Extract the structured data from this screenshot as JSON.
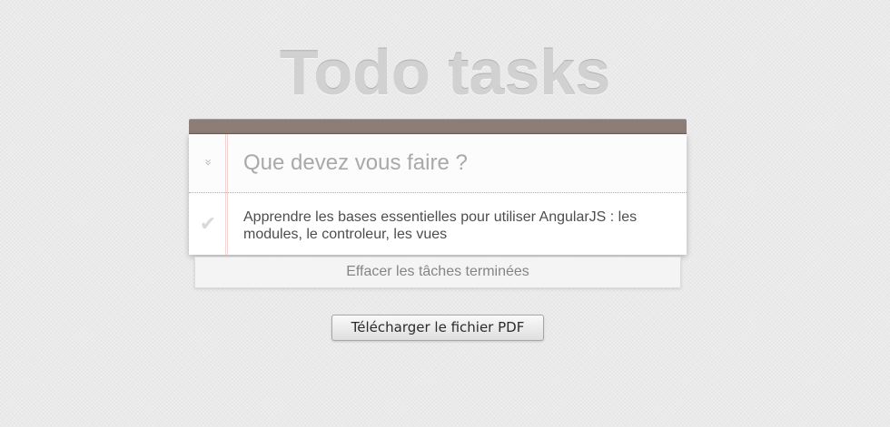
{
  "header": {
    "title": "Todo tasks"
  },
  "new_todo": {
    "placeholder": "Que devez vous faire ?",
    "value": ""
  },
  "toggle_all": {
    "icon": "chevron-double-down-icon"
  },
  "todos": [
    {
      "label": "Apprendre les bases essentielles pour utiliser AngularJS : les modules, le controleur, les vues",
      "completed": false,
      "icon": "check-icon"
    }
  ],
  "footer": {
    "clear_label": "Effacer les tâches terminées"
  },
  "download": {
    "label": "Télécharger le fichier PDF"
  },
  "colors": {
    "background": "#eaeaea",
    "header_bar": "#8d7d77",
    "margin_line": "#f5d6d6",
    "title": "#d1d1d1"
  }
}
